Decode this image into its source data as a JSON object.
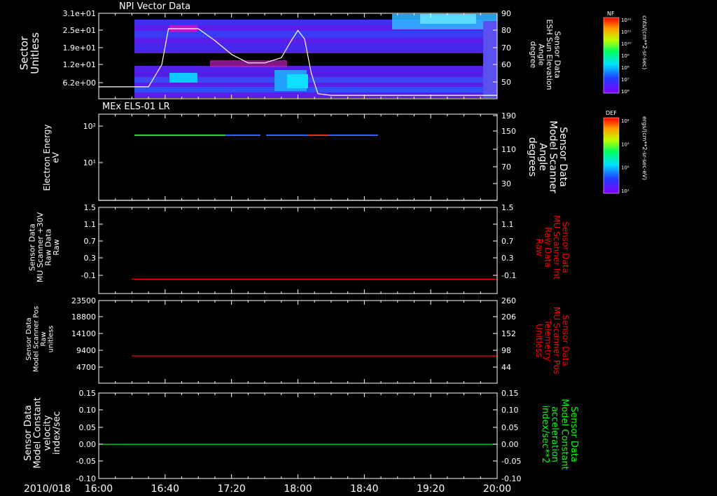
{
  "date_label": "2010/018",
  "time_ticks": [
    "16:00",
    "16:40",
    "17:20",
    "18:00",
    "18:40",
    "19:20",
    "20:00"
  ],
  "colors": {
    "white": "#ffffff",
    "red": "#ff0000",
    "green": "#00ff00",
    "frame": "#ffffff"
  },
  "colorbars": [
    {
      "title": "NF",
      "units": "cnts/(cm**2-sr-sec)",
      "ticks": [
        "10¹²",
        "10¹¹",
        "10¹⁰",
        "10⁹",
        "10⁸",
        "10⁷",
        "10⁶"
      ]
    },
    {
      "title": "DEF",
      "units": "ergs/(cm**2-sr-sec-eV)",
      "ticks": [
        "10⁴",
        "10³",
        "10²",
        "10¹"
      ]
    }
  ],
  "chart_data": [
    {
      "type": "heatmap",
      "title": "NPI Vector Data",
      "ylabel": [
        "Sector",
        "Unitless"
      ],
      "yticks": [
        "3.1e+01",
        "2.5e+01",
        "1.9e+01",
        "1.2e+01",
        "6.2e+00"
      ],
      "right_ylabel": [
        "Sensor Data",
        "ESH Sun Elevation",
        "Angle",
        "degree"
      ],
      "right_yticks": [
        "90",
        "80",
        "70",
        "60",
        "50"
      ],
      "right_ylim": [
        40,
        90
      ],
      "overlay_line": {
        "name": "ESH Sun Elevation Angle",
        "x": [
          "16:00",
          "16:30",
          "16:38",
          "16:42",
          "16:48",
          "17:00",
          "17:10",
          "17:20",
          "17:30",
          "17:40",
          "17:50",
          "17:56",
          "18:00",
          "18:04",
          "18:08",
          "18:12",
          "18:20",
          "20:00"
        ],
        "y": [
          47,
          47,
          60,
          81,
          81,
          81,
          74,
          66,
          61,
          61,
          64,
          74,
          80,
          75,
          55,
          43,
          42,
          42
        ]
      }
    },
    {
      "type": "heatmap",
      "title": "MEx ELS-01 LR",
      "ylabel": [
        "Electron Energy",
        "eV"
      ],
      "yticks": [
        "10²",
        "10¹"
      ],
      "right_ylabel": [
        "Sensor Data",
        "Model Scanner",
        "Angle",
        "degrees"
      ],
      "right_yticks": [
        "190",
        "150",
        "110",
        "70",
        "30"
      ],
      "right_ylim": [
        10,
        190
      ],
      "overlay_line": {
        "name": "Model Scanner Angle",
        "x": [
          "16:00",
          "20:00"
        ],
        "y": [
          10,
          10
        ]
      }
    },
    {
      "type": "line",
      "ylabel": [
        "Sensor Data",
        "MU Scanner +30V",
        "Raw Data",
        "Raw"
      ],
      "yticks": [
        "1.5",
        "1.1",
        "0.7",
        "0.3",
        "-0.1"
      ],
      "ylim": [
        -0.3,
        1.5
      ],
      "right_ylabel": [
        "Sensor Data",
        "MU Scanner Int",
        "Raw Data",
        "Raw"
      ],
      "right_yticks": [
        "1.5",
        "1.1",
        "0.7",
        "0.3",
        "-0.1"
      ],
      "series": [
        {
          "name": "MU Scanner Int Raw Data",
          "x": [
            "16:20",
            "20:00"
          ],
          "y": [
            0.0,
            0.0
          ]
        }
      ]
    },
    {
      "type": "line",
      "ylabel": [
        "Sensor Data",
        "Model Scanner Pos",
        "Raw",
        "unitless"
      ],
      "yticks": [
        "23500",
        "18800",
        "14100",
        "9400",
        "4700"
      ],
      "ylim": [
        0,
        23500
      ],
      "right_ylabel": [
        "Sensor Data",
        "MU Scanner Pos",
        "Telemetry",
        "Unitless"
      ],
      "right_yticks": [
        "260",
        "206",
        "152",
        "98",
        "44"
      ],
      "series": [
        {
          "name": "MU Scanner Pos Telemetry",
          "x": [
            "16:20",
            "20:00"
          ],
          "y": [
            86,
            86
          ]
        }
      ]
    },
    {
      "type": "line",
      "ylabel": [
        "Sensor Data",
        "Model Constant",
        "velocity",
        "index/sec"
      ],
      "yticks": [
        "0.15",
        "0.10",
        "0.05",
        "0.00",
        "-0.05",
        "-0.10"
      ],
      "ylim": [
        -0.1,
        0.15
      ],
      "right_ylabel": [
        "Sensor Data",
        "Model Constant",
        "acceleration",
        "index/sec**2"
      ],
      "right_yticks": [
        "0.15",
        "0.10",
        "0.05",
        "0.00",
        "-0.05",
        "-0.10"
      ],
      "series": [
        {
          "name": "Model Constant acceleration",
          "x": [
            "16:00",
            "20:00"
          ],
          "y": [
            0.0,
            0.0
          ]
        }
      ]
    }
  ]
}
